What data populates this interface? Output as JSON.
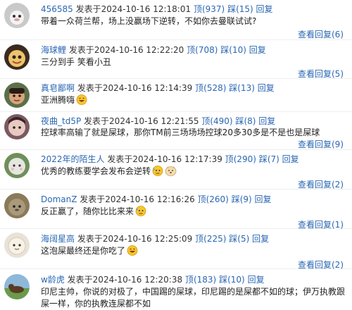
{
  "labels": {
    "posted_at": "发表于",
    "up": "顶",
    "down": "踩",
    "reply": "回复",
    "view_replies": "查看回复"
  },
  "comments": [
    {
      "user": "456585",
      "time": "2024-10-16  12:18:01",
      "up": "(937)",
      "down": "(15)",
      "text": "带着一众荷兰帮，场上没赢场下逆转，不如你去曼联试试?",
      "replies": "(6)"
    },
    {
      "user": "海球鲤",
      "time": "2024-10-16  12:22:20",
      "up": "(708)",
      "down": "(10)",
      "text": "三分到手 笑看小丑",
      "replies": "(5)"
    },
    {
      "user": "真皂鄙啊",
      "time": "2024-10-16  12:14:39",
      "up": "(528)",
      "down": "(13)",
      "text": "亚洲腾嗨",
      "replies": ""
    },
    {
      "user": "夜曲_td5P",
      "time": "2024-10-16  12:21:55",
      "up": "(490)",
      "down": "(8)",
      "text": "控球率高输了就是屎球，那你TM前三场场场控球20多30多是不是也是屎球",
      "replies": "(9)"
    },
    {
      "user": "2022年的陌生人",
      "time": "2024-10-16  12:17:39",
      "up": "(290)",
      "down": "(7)",
      "text": "优秀的教练要学会发布会逆转",
      "replies": "(2)"
    },
    {
      "user": "DomanZ",
      "time": "2024-10-16  12:16:26",
      "up": "(260)",
      "down": "(9)",
      "text": "反正赢了，随你比比来来",
      "replies": "(1)"
    },
    {
      "user": "海阔星高",
      "time": "2024-10-16  12:25:09",
      "up": "(225)",
      "down": "(5)",
      "text": "这泡屎最终还是你吃了",
      "replies": "(2)"
    },
    {
      "user": "w龄虎",
      "time": "2024-10-16  12:20:38",
      "up": "(183)",
      "down": "(10)",
      "text": "印尼主帅，你说的对极了，中国踢的屎球，印尼踢的是屎都不如的球；伊万执教跟屎一样，你的执教连屎都不如",
      "replies": ""
    }
  ],
  "colors": {
    "link": "#2a67b3",
    "text": "#222222",
    "divider": "#eeeeee"
  }
}
